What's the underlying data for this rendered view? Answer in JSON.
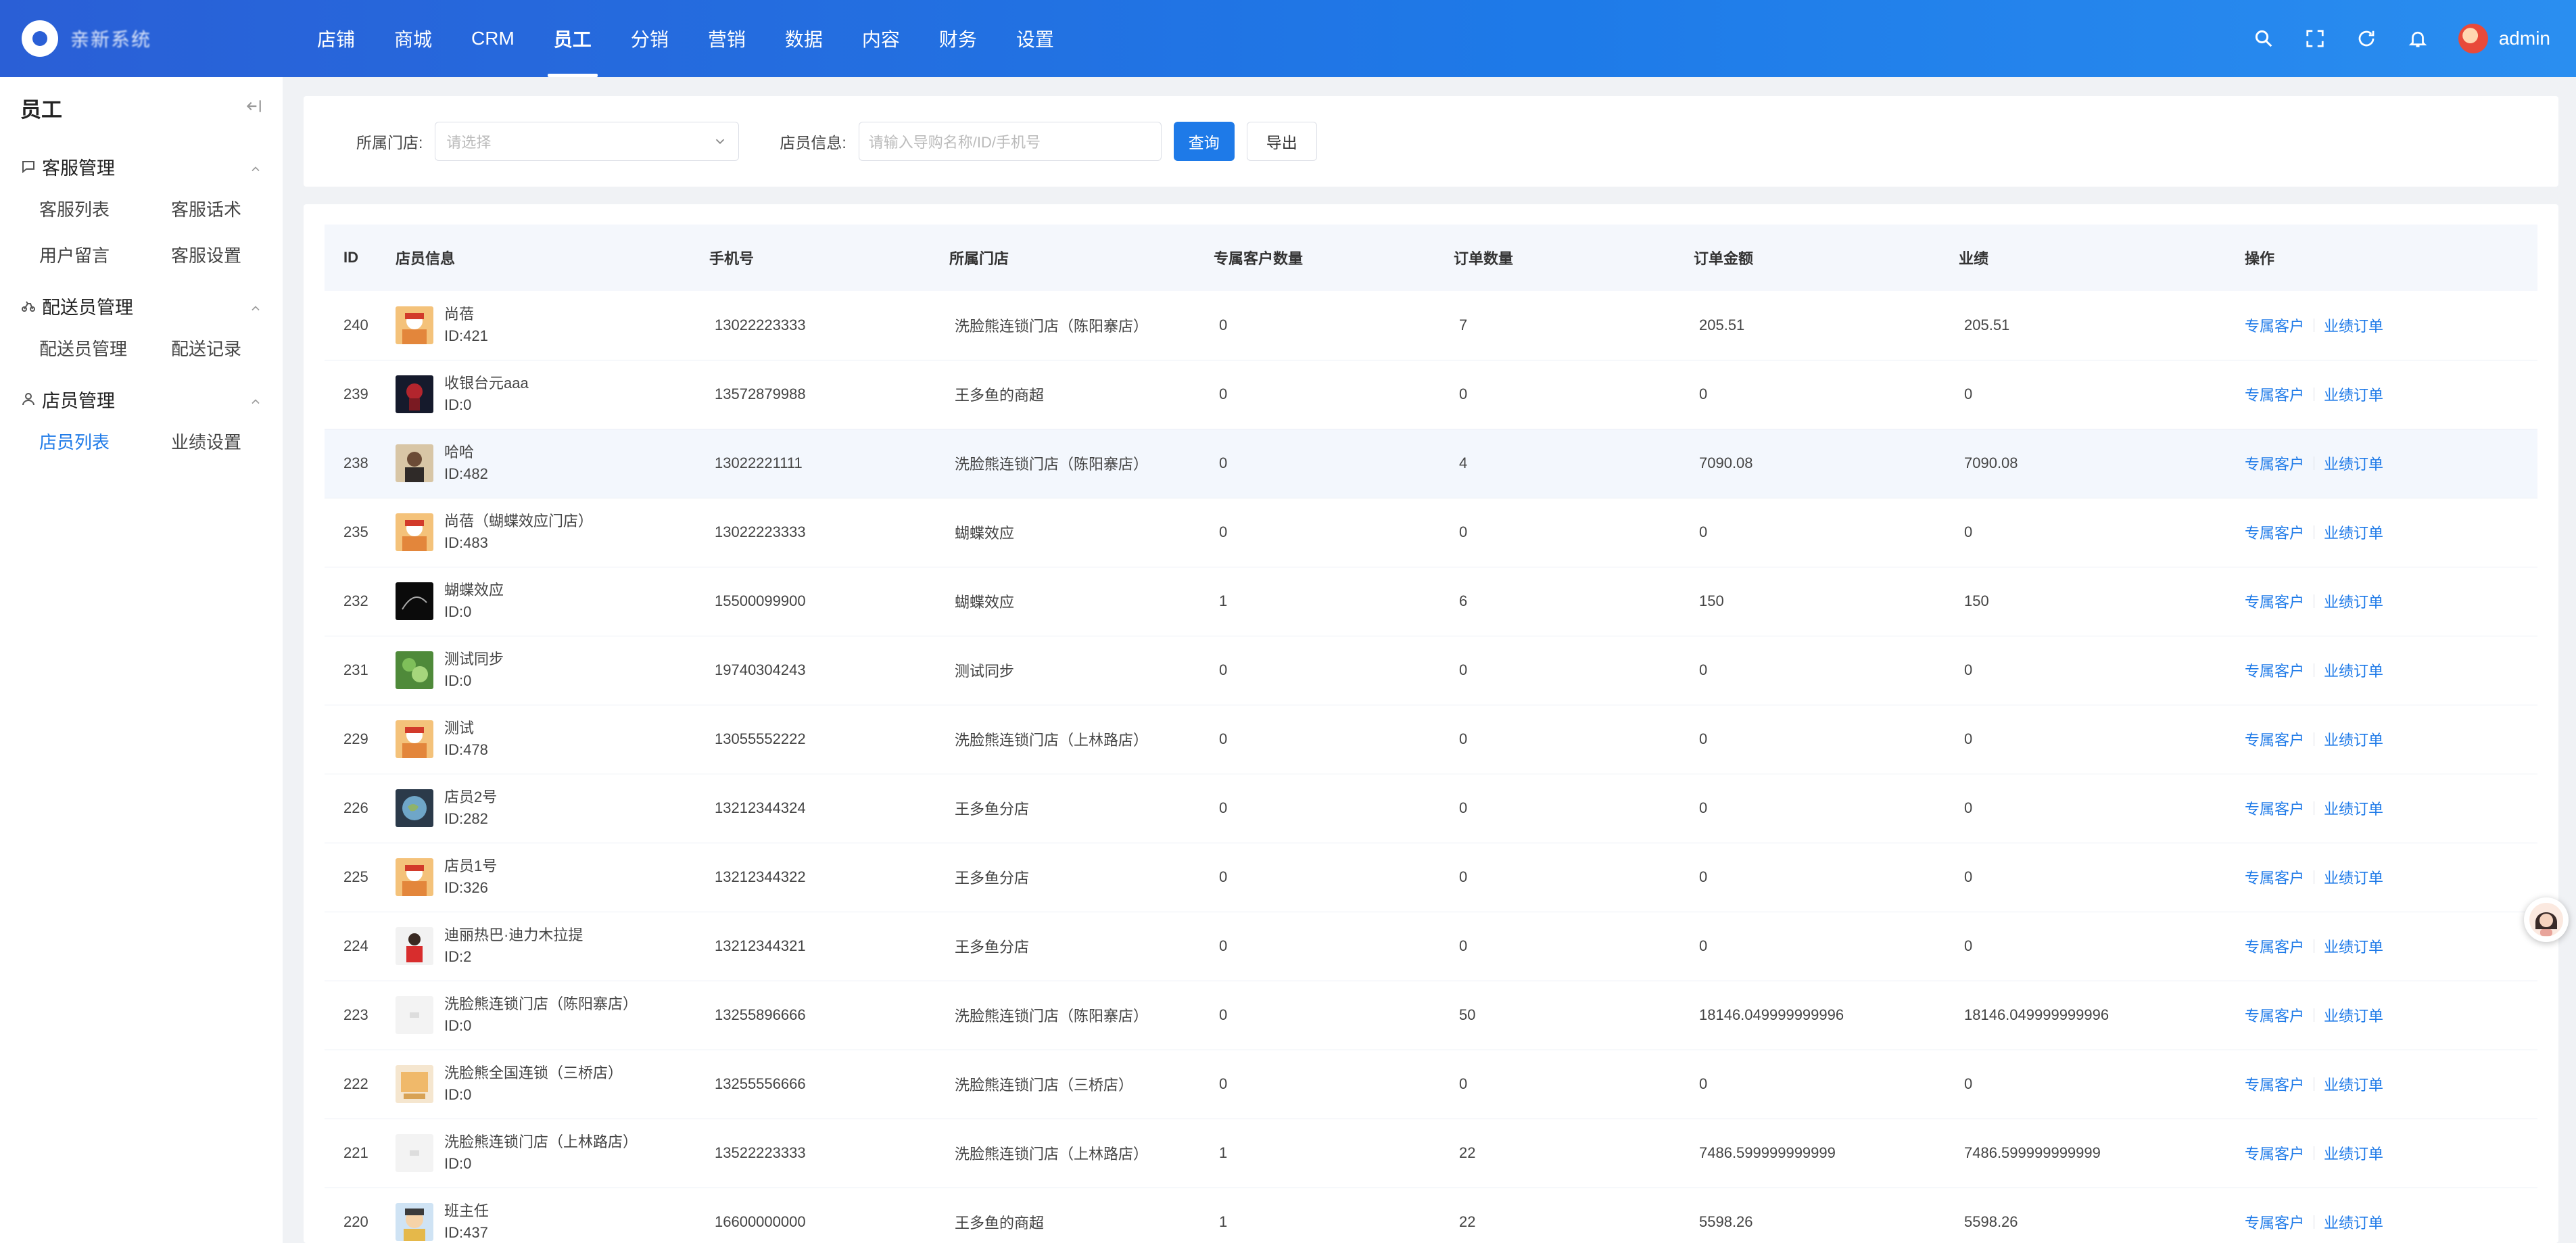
{
  "app": {
    "title": "亲新系统"
  },
  "topnav": [
    {
      "label": "店铺"
    },
    {
      "label": "商城"
    },
    {
      "label": "CRM"
    },
    {
      "label": "员工",
      "active": true
    },
    {
      "label": "分销"
    },
    {
      "label": "营销"
    },
    {
      "label": "数据"
    },
    {
      "label": "内容"
    },
    {
      "label": "财务"
    },
    {
      "label": "设置"
    }
  ],
  "header": {
    "user": "admin",
    "icons": [
      "search-icon",
      "fullscreen-icon",
      "refresh-icon",
      "bell-icon"
    ]
  },
  "sidebar": {
    "title": "员工",
    "groups": [
      {
        "label": "客服管理",
        "icon": "chat-icon",
        "items": [
          {
            "label": "客服列表"
          },
          {
            "label": "客服话术"
          },
          {
            "label": "用户留言"
          },
          {
            "label": "客服设置"
          }
        ]
      },
      {
        "label": "配送员管理",
        "icon": "bike-icon",
        "items": [
          {
            "label": "配送员管理"
          },
          {
            "label": "配送记录"
          }
        ]
      },
      {
        "label": "店员管理",
        "icon": "user-icon",
        "items": [
          {
            "label": "店员列表",
            "active": true
          },
          {
            "label": "业绩设置"
          }
        ]
      }
    ]
  },
  "filter": {
    "store_label": "所属门店:",
    "store_placeholder": "请选择",
    "info_label": "店员信息:",
    "info_placeholder": "请输入导购名称/ID/手机号",
    "query_label": "查询",
    "export_label": "导出"
  },
  "table": {
    "columns": [
      "ID",
      "店员信息",
      "手机号",
      "所属门店",
      "专属客户数量",
      "订单数量",
      "订单金额",
      "业绩",
      "操作"
    ],
    "op_labels": [
      "专属客户",
      "业绩订单"
    ],
    "rows": [
      {
        "id": "240",
        "name": "尚蓓",
        "uid": "ID:421",
        "phone": "13022223333",
        "store": "洗脸熊连锁门店（陈阳寨店）",
        "customers": "0",
        "orders": "7",
        "amount": "205.51",
        "perf": "205.51",
        "avatar": "cartoon"
      },
      {
        "id": "239",
        "name": "收银台元aaa",
        "uid": "ID:0",
        "phone": "13572879988",
        "store": "王多鱼的商超",
        "customers": "0",
        "orders": "0",
        "amount": "0",
        "perf": "0",
        "avatar": "dark-red"
      },
      {
        "id": "238",
        "name": "哈哈",
        "uid": "ID:482",
        "phone": "13022221111",
        "store": "洗脸熊连锁门店（陈阳寨店）",
        "customers": "0",
        "orders": "4",
        "amount": "7090.08",
        "perf": "7090.08",
        "avatar": "portrait",
        "highlight": true
      },
      {
        "id": "235",
        "name": "尚蓓（蝴蝶效应门店）",
        "uid": "ID:483",
        "phone": "13022223333",
        "store": "蝴蝶效应",
        "customers": "0",
        "orders": "0",
        "amount": "0",
        "perf": "0",
        "avatar": "cartoon"
      },
      {
        "id": "232",
        "name": "蝴蝶效应",
        "uid": "ID:0",
        "phone": "15500099900",
        "store": "蝴蝶效应",
        "customers": "1",
        "orders": "6",
        "amount": "150",
        "perf": "150",
        "avatar": "dark"
      },
      {
        "id": "231",
        "name": "测试同步",
        "uid": "ID:0",
        "phone": "19740304243",
        "store": "测试同步",
        "customers": "0",
        "orders": "0",
        "amount": "0",
        "perf": "0",
        "avatar": "green"
      },
      {
        "id": "229",
        "name": "测试",
        "uid": "ID:478",
        "phone": "13055552222",
        "store": "洗脸熊连锁门店（上林路店）",
        "customers": "0",
        "orders": "0",
        "amount": "0",
        "perf": "0",
        "avatar": "cartoon"
      },
      {
        "id": "226",
        "name": "店员2号",
        "uid": "ID:282",
        "phone": "13212344324",
        "store": "王多鱼分店",
        "customers": "0",
        "orders": "0",
        "amount": "0",
        "perf": "0",
        "avatar": "earth"
      },
      {
        "id": "225",
        "name": "店员1号",
        "uid": "ID:326",
        "phone": "13212344322",
        "store": "王多鱼分店",
        "customers": "0",
        "orders": "0",
        "amount": "0",
        "perf": "0",
        "avatar": "cartoon"
      },
      {
        "id": "224",
        "name": "迪丽热巴·迪力木拉提",
        "uid": "ID:2",
        "phone": "13212344321",
        "store": "王多鱼分店",
        "customers": "0",
        "orders": "0",
        "amount": "0",
        "perf": "0",
        "avatar": "red-person"
      },
      {
        "id": "223",
        "name": "洗脸熊连锁门店（陈阳寨店）",
        "uid": "ID:0",
        "phone": "13255896666",
        "store": "洗脸熊连锁门店（陈阳寨店）",
        "customers": "0",
        "orders": "50",
        "amount": "18146.049999999996",
        "perf": "18146.049999999996",
        "avatar": "blank"
      },
      {
        "id": "222",
        "name": "洗脸熊全国连锁（三桥店）",
        "uid": "ID:0",
        "phone": "13255556666",
        "store": "洗脸熊连锁门店（三桥店）",
        "customers": "0",
        "orders": "0",
        "amount": "0",
        "perf": "0",
        "avatar": "beige"
      },
      {
        "id": "221",
        "name": "洗脸熊连锁门店（上林路店）",
        "uid": "ID:0",
        "phone": "13522223333",
        "store": "洗脸熊连锁门店（上林路店）",
        "customers": "1",
        "orders": "22",
        "amount": "7486.599999999999",
        "perf": "7486.599999999999",
        "avatar": "blank"
      },
      {
        "id": "220",
        "name": "班主任",
        "uid": "ID:437",
        "phone": "16600000000",
        "store": "王多鱼的商超",
        "customers": "1",
        "orders": "22",
        "amount": "5598.26",
        "perf": "5598.26",
        "avatar": "cartoon2"
      }
    ]
  },
  "colors": {
    "primary": "#1e7ae8",
    "header_start": "#2a5fd6",
    "header_end": "#2a8ef0",
    "page_bg": "#f0f2f5"
  }
}
